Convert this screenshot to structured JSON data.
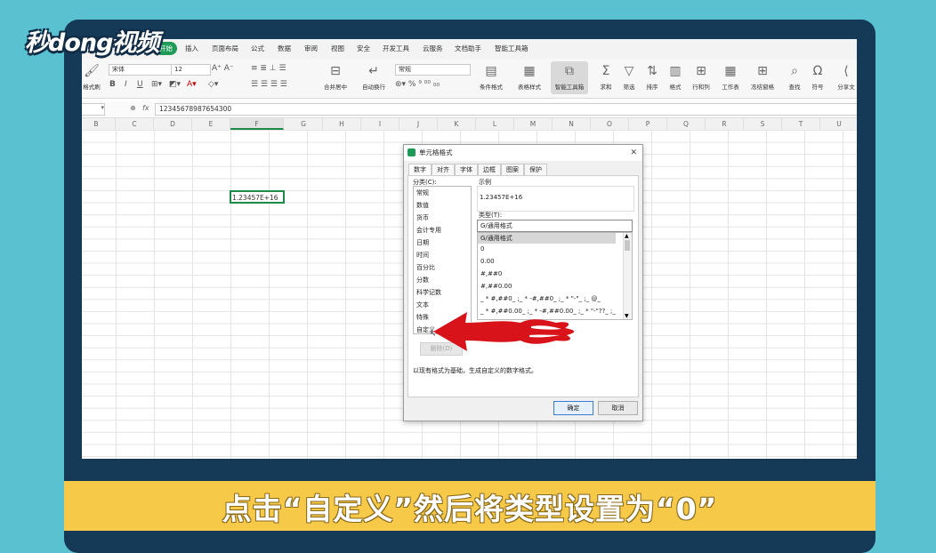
{
  "logo": {
    "text": "秒dong视频"
  },
  "ribbon": {
    "tabs": [
      "开始",
      "插入",
      "页面布局",
      "公式",
      "数据",
      "审阅",
      "视图",
      "安全",
      "开发工具",
      "云服务",
      "文档助手",
      "智能工具箱"
    ],
    "font_name": "宋体",
    "font_size": "12",
    "number_format": "常规",
    "tools": {
      "format_painter": "格式刷",
      "merge_center": "合并居中",
      "auto_wrap": "自动换行",
      "conditional_format": "条件格式",
      "table_style": "表格样式",
      "smart_toolbox": "智能工具箱",
      "sum": "求和",
      "filter": "筛选",
      "sort": "排序",
      "format": "格式",
      "row_col": "行和列",
      "worksheet": "工作表",
      "freeze": "冻结窗格",
      "find": "查找",
      "symbol": "符号",
      "share": "分享文"
    }
  },
  "formula_bar": {
    "fx": "fx",
    "value": "12345678987654300"
  },
  "columns": [
    "B",
    "C",
    "D",
    "E",
    "F",
    "G",
    "H",
    "I",
    "J",
    "K",
    "L",
    "M",
    "N",
    "O",
    "P",
    "Q",
    "R",
    "S",
    "T",
    "U"
  ],
  "active_cell": {
    "display": "1.23457E+16"
  },
  "dialog": {
    "title": "单元格格式",
    "tabs": [
      "数字",
      "对齐",
      "字体",
      "边框",
      "图案",
      "保护"
    ],
    "category_label": "分类(C):",
    "categories": [
      "常规",
      "数值",
      "货币",
      "会计专用",
      "日期",
      "时间",
      "百分比",
      "分数",
      "科学记数",
      "文本",
      "特殊",
      "自定义"
    ],
    "sample_label": "示例",
    "sample_value": "1.23457E+16",
    "type_label": "类型(T):",
    "type_value": "G/通用格式",
    "type_options": [
      "G/通用格式",
      "0",
      "0.00",
      "#,##0",
      "#,##0.00",
      "_ * #,##0_ ;_ * -#,##0_ ;_ * \"-\"_ ;_ @_",
      "_ * #,##0.00_ ;_ * -#,##0.00_ ;_ * \"-\"??_ ;_ @_"
    ],
    "delete_button": "删除(D)",
    "description": "以现有格式为基础，生成自定义的数字格式。",
    "ok_button": "确定",
    "cancel_button": "取消"
  },
  "caption": {
    "text": "点击“自定义”然后将类型设置为“0”"
  },
  "colors": {
    "background": "#59c1cf",
    "frame": "#153a58",
    "caption_bar": "#f7c948",
    "accent_green": "#1e9b56",
    "arrow_red": "#d8141a"
  }
}
